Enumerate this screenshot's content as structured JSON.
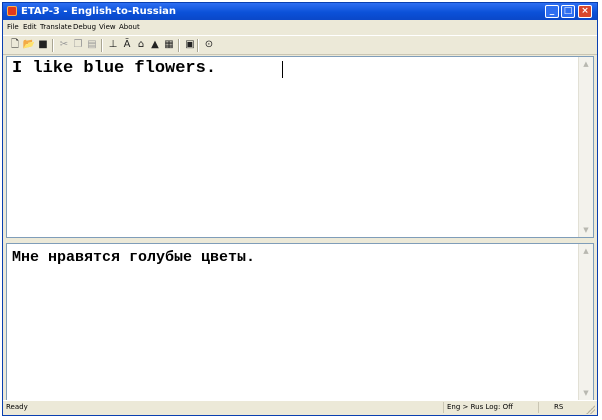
{
  "window": {
    "title": "ETAP-3 - English-to-Russian"
  },
  "menu": [
    "File",
    "Edit",
    "Translate",
    "Debug",
    "View",
    "About"
  ],
  "toolbar": {
    "buttons": [
      {
        "icon": "new-document-icon",
        "glyph": "🗋",
        "enabled": true
      },
      {
        "icon": "open-folder-icon",
        "glyph": "📂",
        "enabled": true
      },
      {
        "icon": "save-icon",
        "glyph": "■",
        "enabled": true
      },
      {
        "icon": "cut-icon",
        "glyph": "✂",
        "enabled": false
      },
      {
        "icon": "copy-icon",
        "glyph": "❐",
        "enabled": false
      },
      {
        "icon": "paste-icon",
        "glyph": "▤",
        "enabled": false
      },
      {
        "icon": "translate-icon",
        "glyph": "⊥",
        "enabled": true
      },
      {
        "icon": "translate-all-icon",
        "glyph": "Ā",
        "enabled": true
      },
      {
        "icon": "tree-view-icon",
        "glyph": "⌂",
        "enabled": true
      },
      {
        "icon": "syntax-icon",
        "glyph": "▲",
        "enabled": true
      },
      {
        "icon": "dictionary-icon",
        "glyph": "▦",
        "enabled": true
      },
      {
        "icon": "options-icon",
        "glyph": "▣",
        "enabled": true
      },
      {
        "icon": "help-icon",
        "glyph": "⊙",
        "enabled": true
      }
    ]
  },
  "source": {
    "text": "I like blue flowers."
  },
  "target": {
    "text": "Мне нравятся голубые цветы."
  },
  "status": {
    "left": "Ready",
    "mode": "Eng > Rus Log: Off",
    "extra": "RS"
  },
  "colors": {
    "titlebar": "#0b51d8",
    "frame": "#ece9d8",
    "close": "#d8472b"
  }
}
